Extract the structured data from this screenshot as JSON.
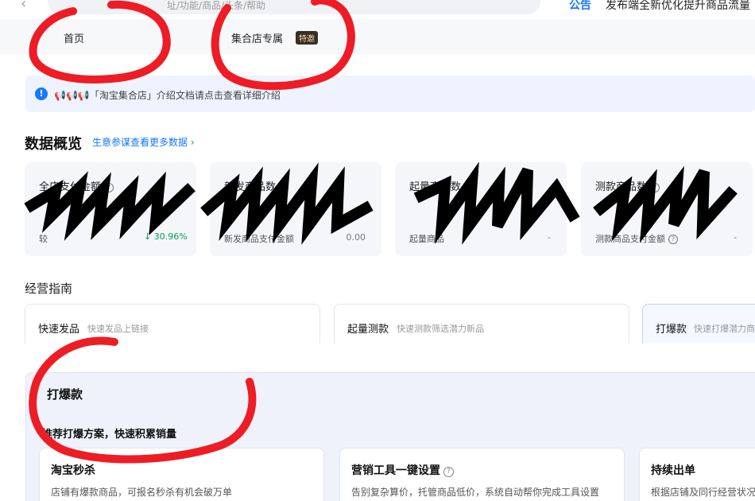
{
  "topbar": {
    "back_icon": "chevron-left-icon",
    "search_placeholder": "址/功能/商品/头条/帮助",
    "announcement_tag": "公告",
    "announcement_text": "发布端全新优化提升商品流量"
  },
  "tabs": {
    "home": "首页",
    "store": "集合店专属",
    "store_badge": "特邀"
  },
  "notice": {
    "icon": "info-icon",
    "text": "📢📢📢「淘宝集合店」介绍文档请点击查看详细介绍"
  },
  "data_overview": {
    "title": "数据概览",
    "link": "生意参谋查看更多数据 ›",
    "metrics": [
      {
        "label": "全店支付金额",
        "sub_label": "较",
        "growth": "↓ 30.96%"
      },
      {
        "label": "新发商品数",
        "sub_label": "新发商品支付金额",
        "sub_value": "0.00"
      },
      {
        "label": "起量商品数",
        "sub_label": "起量商品",
        "sub_value": "-"
      },
      {
        "label": "测款商品数",
        "sub_label": "测款商品支付金额",
        "sub_value": "-"
      }
    ]
  },
  "guide": {
    "title": "经营指南",
    "cards": [
      {
        "name": "快速发品",
        "desc": "快速发品上链接"
      },
      {
        "name": "起量测款",
        "desc": "快速测款筛选潜力新品"
      },
      {
        "name": "打爆款",
        "desc": "快速打爆潜力商"
      }
    ]
  },
  "panel": {
    "title": "打爆款",
    "subtitle": "推荐打爆方案，快速积累销量",
    "tools": [
      {
        "name": "淘宝秒杀",
        "desc": "店铺有爆款商品，可报名秒杀有机会破万单"
      },
      {
        "name": "营销工具一键设置",
        "desc": "告别复杂算价，托管商品低价，系统自动帮你完成工具设置"
      },
      {
        "name": "持续出单",
        "desc": "根据店铺及同行经营状况"
      }
    ]
  },
  "colors": {
    "accent": "#1677ff",
    "annotation_red": "#ee1c25",
    "growth_green": "#0a9d58"
  }
}
